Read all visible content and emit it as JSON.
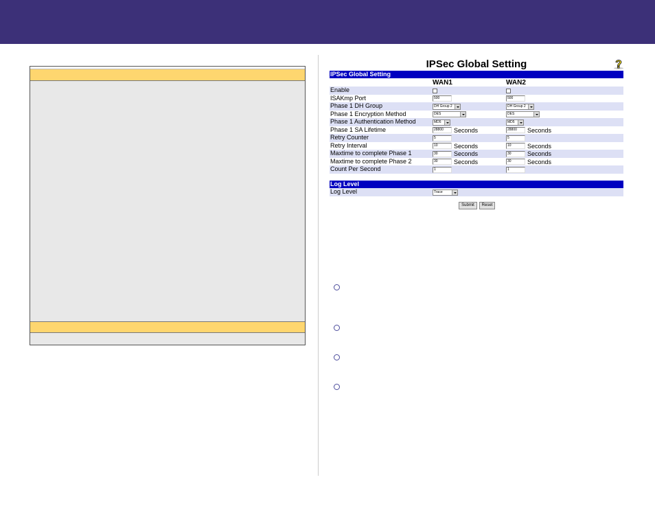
{
  "ipsec": {
    "title": "IPSec Global Setting",
    "section_header": "IPSec Global Setting",
    "columns": [
      "WAN1",
      "WAN2"
    ],
    "unit_seconds": "Seconds",
    "rows": [
      {
        "label": "Enable"
      },
      {
        "label": "ISAKmp Port",
        "wan1": "500",
        "wan2": "500"
      },
      {
        "label": "Phase 1 DH Group",
        "wan1": "DH Group 2",
        "wan2": "DH Group 2"
      },
      {
        "label": "Phase 1 Encryption Method",
        "wan1": "DES",
        "wan2": "DES"
      },
      {
        "label": "Phase 1 Authentication Method",
        "wan1": "MD5",
        "wan2": "MD5"
      },
      {
        "label": "Phase 1 SA Lifetime",
        "wan1": "28800",
        "wan2": "28800"
      },
      {
        "label": "Retry Counter",
        "wan1": "5",
        "wan2": "5"
      },
      {
        "label": "Retry Interval",
        "wan1": "10",
        "wan2": "10"
      },
      {
        "label": "Maxtime to complete Phase 1",
        "wan1": "30",
        "wan2": "30"
      },
      {
        "label": "Maxtime to complete Phase 2",
        "wan1": "30",
        "wan2": "30"
      },
      {
        "label": "Count Per Second",
        "wan1": "1",
        "wan2": "1"
      }
    ],
    "log_header": "Log Level",
    "log_label": "Log Level",
    "log_value": "Trace",
    "submit_label": "Submit",
    "reset_label": "Reset"
  },
  "colors": {
    "banner": "#3c3078",
    "section_header": "#0000c0",
    "row_alt": "#dde0f5",
    "panel_bar": "#fed66f"
  }
}
